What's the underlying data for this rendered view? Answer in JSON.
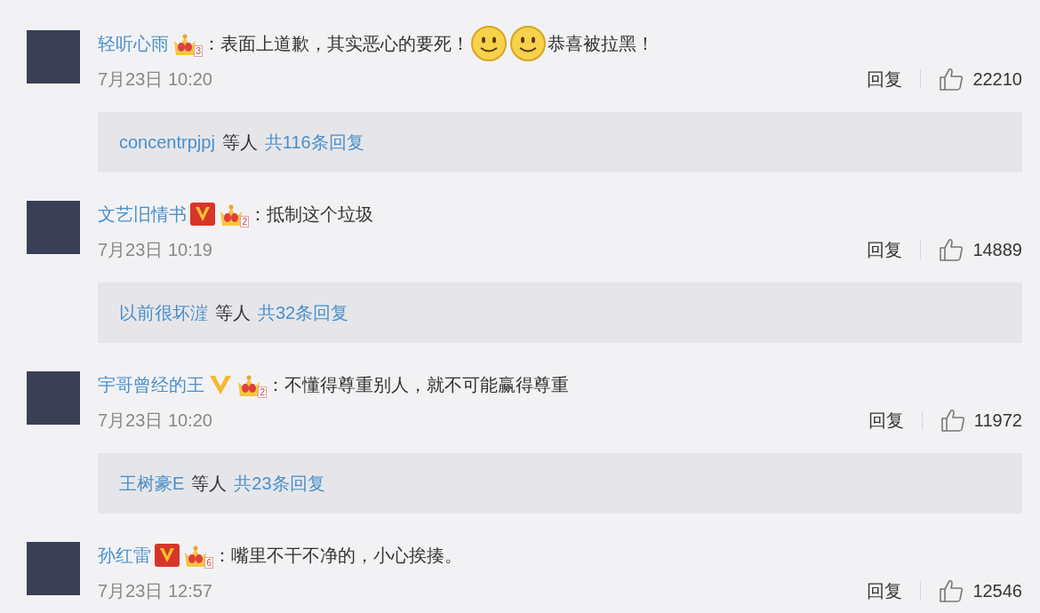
{
  "comments": [
    {
      "user": "轻听心雨",
      "kind": "unverified",
      "crown_level": "3",
      "content": [
        {
          "kind": "text",
          "text": "：表面上道歉，其实恶心的要死！"
        },
        {
          "kind": "emoji"
        },
        {
          "kind": "emoji"
        },
        {
          "kind": "text",
          "text": "恭喜被拉黑！"
        }
      ],
      "time": "7月23日 10:20",
      "reply_label": "回复",
      "likes": "22210",
      "thread": {
        "names": "concentrpjpj",
        "suffix": "等人",
        "count": "共116条回复"
      }
    },
    {
      "user": "文艺旧情书",
      "kind": "boxed",
      "crown_level": "2",
      "content": [
        {
          "kind": "text",
          "text": "：抵制这个垃圾"
        }
      ],
      "time": "7月23日 10:19",
      "reply_label": "回复",
      "likes": "14889",
      "thread": {
        "names": "以前很坏漄",
        "suffix": "等人",
        "count": "共32条回复"
      }
    },
    {
      "user": "宇哥曾经的王",
      "kind": "plain",
      "crown_level": "2",
      "content": [
        {
          "kind": "text",
          "text": "：不懂得尊重别人，就不可能赢得尊重"
        }
      ],
      "time": "7月23日 10:20",
      "reply_label": "回复",
      "likes": "11972",
      "thread": {
        "names": "王树豪E",
        "suffix": "等人",
        "count": "共23条回复"
      }
    },
    {
      "user": "孙红雷",
      "kind": "boxed",
      "crown_level": "6",
      "content": [
        {
          "kind": "text",
          "text": "：嘴里不干不净的，小心挨揍。"
        }
      ],
      "time": "7月23日 12:57",
      "reply_label": "回复",
      "likes": "12546"
    }
  ]
}
